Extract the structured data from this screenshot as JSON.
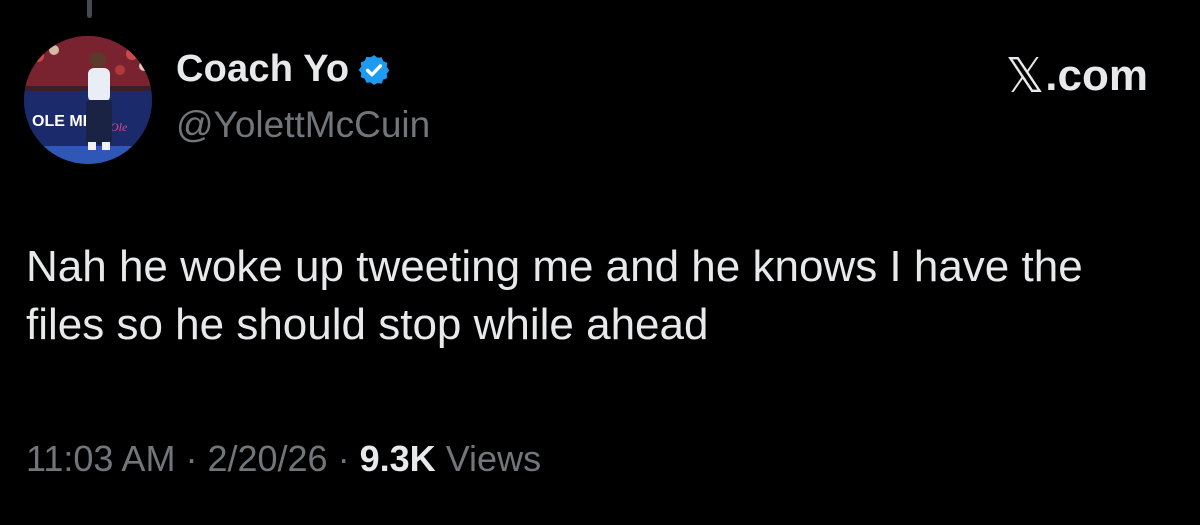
{
  "author": {
    "display_name": "Coach Yo",
    "handle": "@YolettMcCuin",
    "verified": true,
    "avatar_banner_text": "OLE MI"
  },
  "watermark": {
    "glyph": "𝕏",
    "suffix": ".com"
  },
  "tweet": {
    "text": "Nah he woke up tweeting me and he knows I have the files so he should stop while ahead"
  },
  "meta": {
    "time": "11:03 AM",
    "separator": "·",
    "date": "2/20/26",
    "views_count": "9.3K",
    "views_label": "Views"
  },
  "colors": {
    "background": "#000000",
    "primary_text": "#e7e9ea",
    "secondary_text": "#71767b",
    "verified_badge": "#1d9bf0"
  }
}
